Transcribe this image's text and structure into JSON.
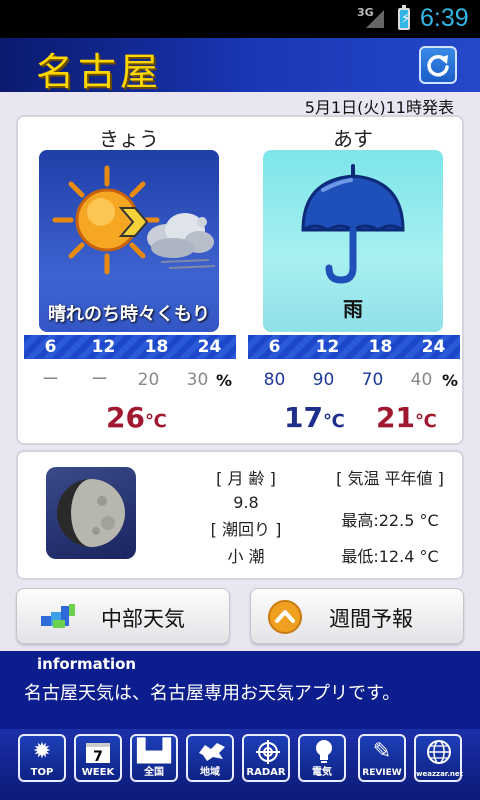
{
  "status_bar": {
    "network": "3G",
    "time": "6:39"
  },
  "header": {
    "city": "名古屋",
    "refresh_icon": "refresh-icon"
  },
  "issued_at": "5月1日(火)11時発表",
  "forecast": {
    "today": {
      "label": "きょう",
      "weather": "晴れのち時々くもり",
      "icon": "sun-cloud-icon",
      "hours": [
        "6",
        "12",
        "18",
        "24"
      ],
      "pops": [
        "ー",
        "ー",
        "20",
        "30"
      ],
      "temp_max": "26",
      "temp_unit": "℃"
    },
    "tomorrow": {
      "label": "あす",
      "weather": "雨",
      "icon": "umbrella-icon",
      "hours": [
        "6",
        "12",
        "18",
        "24"
      ],
      "pops": [
        "80",
        "90",
        "70",
        "40"
      ],
      "temp_min": "17",
      "temp_max": "21",
      "temp_unit": "℃"
    },
    "pop_unit": "%"
  },
  "moon": {
    "age_label": "[ 月 齢 ]",
    "age_value": "9.8",
    "tide_label": "[ 潮回り ]",
    "tide_value": "小 潮",
    "normal_label": "[ 気温 平年値 ]",
    "normal_high": "最高:22.5 °C",
    "normal_low": "最低:12.4 °C"
  },
  "nav_buttons": {
    "regional": "中部天気",
    "weekly": "週間予報"
  },
  "info": {
    "title": "information",
    "message": "名古屋天気は、名古屋専用お天気アプリです。"
  },
  "tabs": [
    {
      "label": "TOP",
      "icon": "sun-icon"
    },
    {
      "label": "WEEK",
      "icon": "calendar-icon",
      "number": "7"
    },
    {
      "label": "全国",
      "icon": "buildings-icon"
    },
    {
      "label": "地域",
      "icon": "hokkaido-map-icon"
    },
    {
      "label": "RADAR",
      "icon": "radar-icon"
    },
    {
      "label": "電気",
      "icon": "lightbulb-icon"
    },
    {
      "label": "REVIEW",
      "icon": "pencil-icon"
    },
    {
      "label": "weazzar.net",
      "icon": "globe-icon"
    }
  ],
  "colors": {
    "header_bg": "#1a38b8",
    "city_text": "#ffd700",
    "temp_max": "#a01830",
    "temp_min": "#1d2f8a",
    "info_bg": "#0c1e8e"
  }
}
